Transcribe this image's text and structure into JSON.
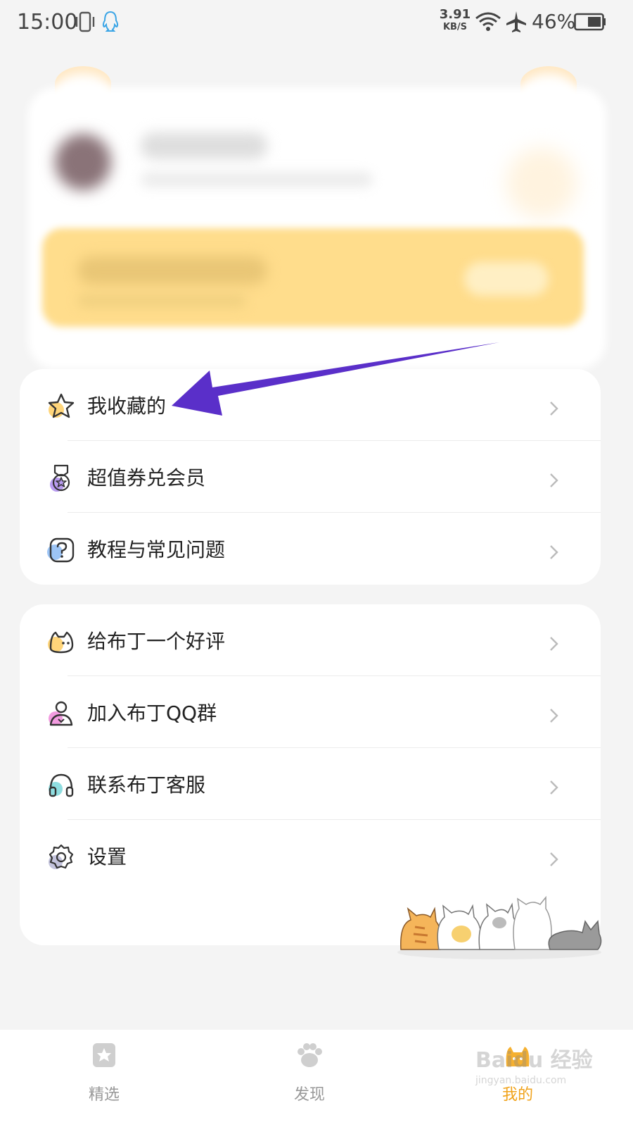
{
  "status_bar": {
    "time": "15:00",
    "net_speed_value": "3.91",
    "net_speed_unit": "KB/S",
    "battery": "46%",
    "icons": [
      "vibrate-icon",
      "qq-icon",
      "wifi-icon",
      "airplane-icon",
      "battery-icon"
    ]
  },
  "menu_group_1": [
    {
      "label": "我收藏的",
      "icon": "star-icon"
    },
    {
      "label": "超值券兑会员",
      "icon": "medal-icon"
    },
    {
      "label": "教程与常见问题",
      "icon": "help-icon"
    }
  ],
  "menu_group_2": [
    {
      "label": "给布丁一个好评",
      "icon": "cat-face-icon"
    },
    {
      "label": "加入布丁QQ群",
      "icon": "group-user-icon"
    },
    {
      "label": "联系布丁客服",
      "icon": "headset-icon"
    },
    {
      "label": "设置",
      "icon": "settings-icon"
    }
  ],
  "bottom_nav": {
    "items": [
      {
        "label": "精选",
        "icon": "star-bookmark-icon"
      },
      {
        "label": "发现",
        "icon": "paw-icon"
      },
      {
        "label": "我的",
        "icon": "cat-paw-icon",
        "active": true
      }
    ]
  },
  "watermark": {
    "brand": "Baidu 经验",
    "url": "jingyan.baidu.com"
  },
  "colors": {
    "accent": "#f0a21a",
    "arrow": "#5a2fc9",
    "vip_banner": "#ffdd8c"
  }
}
